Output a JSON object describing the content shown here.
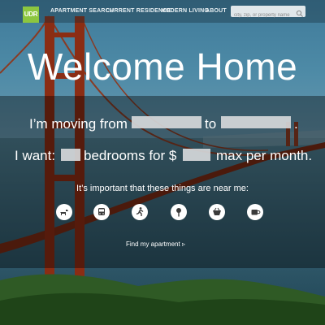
{
  "nav": {
    "logo": "UDR",
    "items": [
      "APARTMENT SEARCH",
      "CURRENT RESIDENCE",
      "MODERN LIVING",
      "ABOUT"
    ],
    "search_placeholder": "city, zip, or property name"
  },
  "hero": {
    "title": "Welcome Home"
  },
  "form": {
    "moving_prefix": "I’m moving from",
    "moving_to": "to",
    "moving_end": ".",
    "want_prefix": "I want:",
    "bedrooms_text": "bedrooms for $",
    "max_text": "max per month.",
    "near_prompt": "It’s important that these things are near me:",
    "amenities": [
      "dog-park-icon",
      "transit-icon",
      "fitness-icon",
      "restaurant-icon",
      "grocery-icon",
      "coffee-icon"
    ],
    "find_label": "Find my apartment",
    "find_arrow": "▹"
  }
}
